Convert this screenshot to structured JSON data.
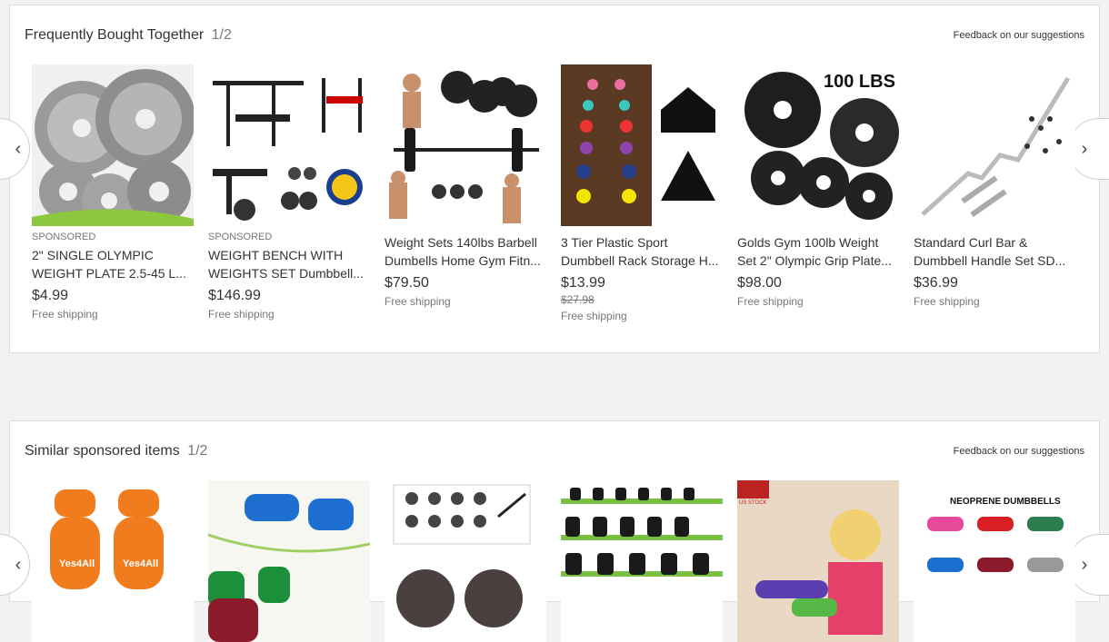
{
  "section1": {
    "title": "Frequently Bought Together",
    "pager": "1/2",
    "feedback": "Feedback on our suggestions",
    "items": [
      {
        "sponsored": "SPONSORED",
        "title": "2\" SINGLE OLYMPIC WEIGHT PLATE 2.5-45 L...",
        "price": "$4.99",
        "shipping": "Free shipping",
        "image_icon": "weight-plates-icon"
      },
      {
        "sponsored": "SPONSORED",
        "title": "WEIGHT BENCH WITH WEIGHTS SET Dumbbell...",
        "price": "$146.99",
        "shipping": "Free shipping",
        "image_icon": "weight-bench-icon"
      },
      {
        "title": "Weight Sets 140lbs Barbell Dumbells Home Gym Fitn...",
        "price": "$79.50",
        "shipping": "Free shipping",
        "image_icon": "barbell-set-icon"
      },
      {
        "title": "3 Tier Plastic Sport Dumbbell Rack Storage H...",
        "price": "$13.99",
        "was_price": "$27.98",
        "shipping": "Free shipping",
        "image_icon": "dumbbell-rack-icon"
      },
      {
        "title": "Golds Gym 100lb Weight Set 2\" Olympic Grip Plate...",
        "price": "$98.00",
        "shipping": "Free shipping",
        "image_icon": "golds-gym-plates-icon",
        "image_text": "100 LBS"
      },
      {
        "title": "Standard Curl Bar & Dumbbell Handle Set SD...",
        "price": "$36.99",
        "shipping": "Free shipping",
        "image_icon": "curl-bar-icon"
      }
    ]
  },
  "section2": {
    "title": "Similar sponsored items",
    "pager": "1/2",
    "feedback": "Feedback on our suggestions",
    "items": [
      {
        "image_icon": "orange-dumbbells-icon",
        "image_text": "Yes4All"
      },
      {
        "image_icon": "neoprene-dumbbells-blue-icon"
      },
      {
        "image_icon": "plate-set-icon"
      },
      {
        "image_icon": "dumbbell-rows-icon"
      },
      {
        "image_icon": "women-exercising-icon",
        "image_text": "US STOCK"
      },
      {
        "image_icon": "neoprene-dumbbells-grid-icon",
        "image_text": "NEOPRENE DUMBBELLS"
      }
    ]
  },
  "colors": {
    "background": "#f2f2f2",
    "panel": "#ffffff",
    "text": "#333333",
    "muted": "#777777",
    "border": "#dddddd"
  }
}
